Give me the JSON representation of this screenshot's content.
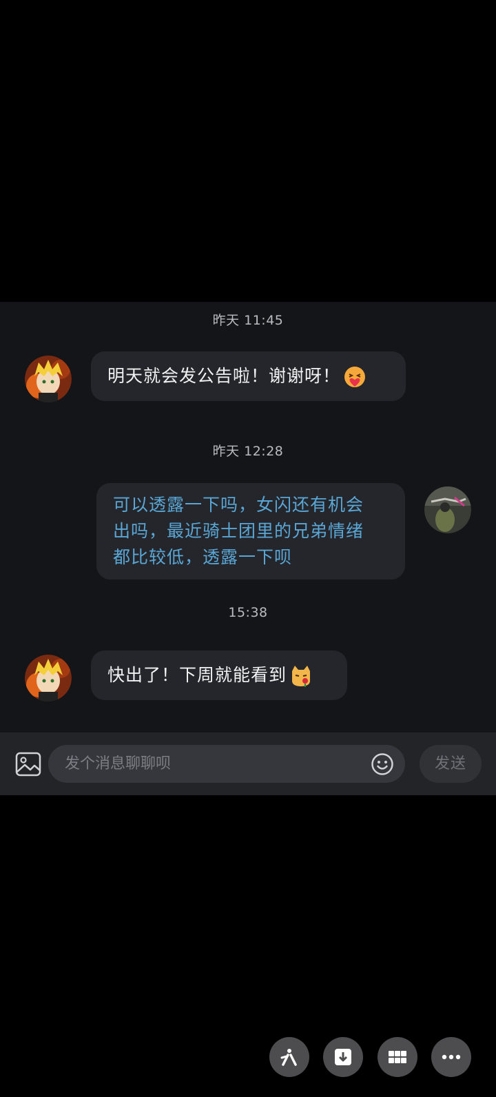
{
  "chat": {
    "messages": [
      {
        "timestamp": "昨天 11:45",
        "sender": "other",
        "text": "明天就会发公告啦！谢谢呀！",
        "emoji": "heart-hug-emoji"
      },
      {
        "timestamp": "昨天 12:28",
        "sender": "self",
        "lines": [
          "可以透露一下吗，女闪还有机会",
          "出吗，最近骑士团里的兄弟情绪",
          "都比较低，透露一下呗"
        ]
      },
      {
        "timestamp": "15:38",
        "sender": "other",
        "text": "快出了！下周就能看到",
        "emoji": "cat-rose-emoji"
      }
    ]
  },
  "input": {
    "placeholder": "发个消息聊聊呗",
    "send_label": "发送"
  },
  "floating_actions": [
    "share-icon",
    "download-icon",
    "grid-icon",
    "more-icon"
  ],
  "colors": {
    "background": "#000000",
    "chat_panel": "#141518",
    "bubble": "#24262b",
    "sent_text": "#5aa7d6",
    "received_text": "#f2f2f2"
  }
}
